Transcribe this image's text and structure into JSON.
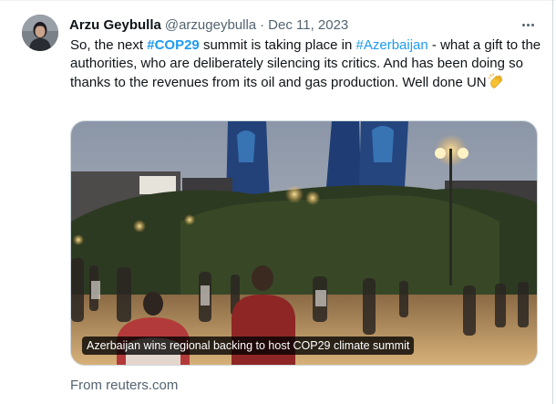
{
  "tweet": {
    "author_name": "Arzu Geybulla",
    "author_handle": "@arzugeybulla",
    "separator": "·",
    "date": "Dec 11, 2023",
    "body_part1": "So, the next ",
    "hashtag1": "#COP29",
    "body_part2": " summit is taking place in ",
    "hashtag2": "#Azerbaijan",
    "body_part3": " - what a gift to the authorities, who are deliberately silencing its critics. And has been doing so thanks to the revenues from its oil and gas production. Well done UN",
    "emoji_icon": "clapping-hands-icon"
  },
  "card": {
    "caption": "Azerbaijan wins regional backing to host COP29 climate summit",
    "source": "From reuters.com"
  },
  "colors": {
    "link": "#1d9bf0",
    "text": "#0f1419",
    "muted": "#536471"
  }
}
